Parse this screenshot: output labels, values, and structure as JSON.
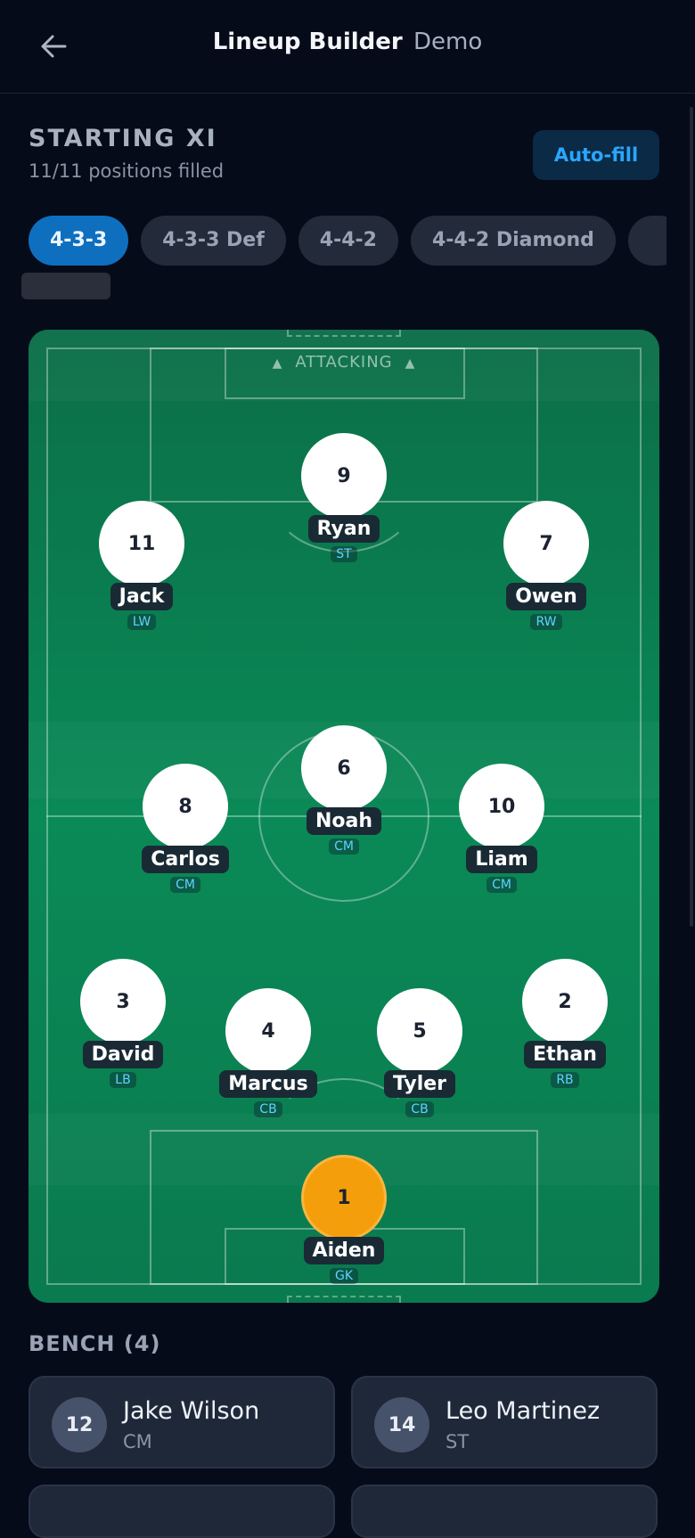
{
  "header": {
    "title": "Lineup Builder",
    "subtitle": "Demo"
  },
  "section": {
    "title": "STARTING XI",
    "status": "11/11 positions filled",
    "autofill_label": "Auto-fill"
  },
  "formations": [
    {
      "label": "4-3-3",
      "active": true
    },
    {
      "label": "4-3-3 Def",
      "active": false
    },
    {
      "label": "4-4-2",
      "active": false
    },
    {
      "label": "4-4-2 Diamond",
      "active": false
    }
  ],
  "pitch": {
    "direction_label": "ATTACKING",
    "players": [
      {
        "number": "9",
        "name": "Ryan",
        "pos": "ST"
      },
      {
        "number": "11",
        "name": "Jack",
        "pos": "LW"
      },
      {
        "number": "7",
        "name": "Owen",
        "pos": "RW"
      },
      {
        "number": "6",
        "name": "Noah",
        "pos": "CM"
      },
      {
        "number": "8",
        "name": "Carlos",
        "pos": "CM"
      },
      {
        "number": "10",
        "name": "Liam",
        "pos": "CM"
      },
      {
        "number": "3",
        "name": "David",
        "pos": "LB"
      },
      {
        "number": "2",
        "name": "Ethan",
        "pos": "RB"
      },
      {
        "number": "4",
        "name": "Marcus",
        "pos": "CB"
      },
      {
        "number": "5",
        "name": "Tyler",
        "pos": "CB"
      },
      {
        "number": "1",
        "name": "Aiden",
        "pos": "GK"
      }
    ]
  },
  "bench": {
    "title": "BENCH (4)",
    "players": [
      {
        "number": "12",
        "name": "Jake Wilson",
        "pos": "CM"
      },
      {
        "number": "14",
        "name": "Leo Martinez",
        "pos": "ST"
      }
    ]
  },
  "colors": {
    "accent": "#0e6fbf",
    "pitch": "#0a8a56",
    "keeper": "#f59e0b",
    "background": "#060b1a"
  }
}
